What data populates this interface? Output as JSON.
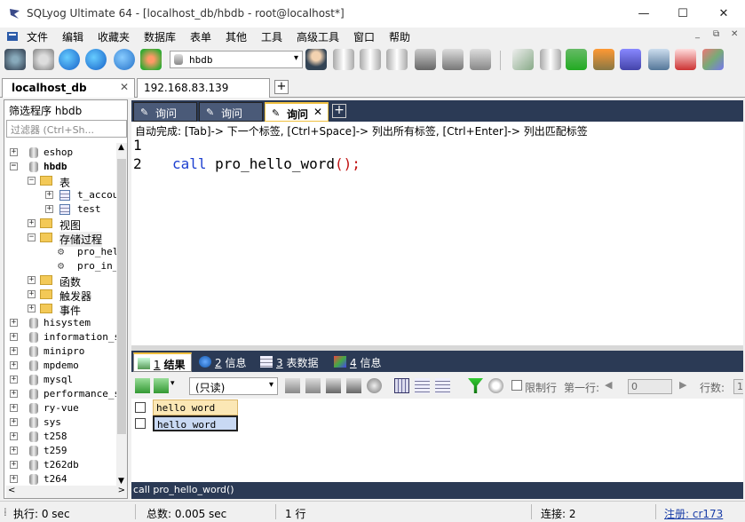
{
  "window": {
    "title": "SQLyog Ultimate 64 - [localhost_db/hbdb - root@localhost*]"
  },
  "menu": [
    "文件",
    "编辑",
    "收藏夹",
    "数据库",
    "表单",
    "其他",
    "工具",
    "高级工具",
    "窗口",
    "帮助"
  ],
  "toolbar": {
    "db_select": "hbdb"
  },
  "connections": [
    {
      "label": "localhost_db"
    },
    {
      "label": "192.168.83.139"
    }
  ],
  "left": {
    "filter_label": "筛选程序 hbdb",
    "filter_placeholder": "过滤器 (Ctrl+Sh...",
    "tree": [
      {
        "label": "eshop"
      },
      {
        "label": "hbdb"
      },
      {
        "label": "表"
      },
      {
        "label": "t_accou"
      },
      {
        "label": "test"
      },
      {
        "label": "视图"
      },
      {
        "label": "存储过程"
      },
      {
        "label": "pro_hel"
      },
      {
        "label": "pro_in_"
      },
      {
        "label": "函数"
      },
      {
        "label": "触发器"
      },
      {
        "label": "事件"
      },
      {
        "label": "hisystem"
      },
      {
        "label": "information_s"
      },
      {
        "label": "minipro"
      },
      {
        "label": "mpdemo"
      },
      {
        "label": "mysql"
      },
      {
        "label": "performance_s"
      },
      {
        "label": "ry-vue"
      },
      {
        "label": "sys"
      },
      {
        "label": "t258"
      },
      {
        "label": "t259"
      },
      {
        "label": "t262db"
      },
      {
        "label": "t264"
      }
    ]
  },
  "query_tabs": [
    {
      "label": "询问"
    },
    {
      "label": "询问"
    },
    {
      "label": "询问"
    }
  ],
  "editor": {
    "hint": "自动完成:  [Tab]-> 下一个标签, [Ctrl+Space]-> 列出所有标签, [Ctrl+Enter]-> 列出匹配标签",
    "line_numbers": [
      "1",
      "2"
    ],
    "keyword": "call",
    "proc": "pro_hello_word",
    "parens": "()",
    "semi": ";"
  },
  "result_tabs": [
    {
      "num": "1",
      "label": "结果"
    },
    {
      "num": "2",
      "label": "信息"
    },
    {
      "num": "3",
      "label": "表数据"
    },
    {
      "num": "4",
      "label": "信息"
    }
  ],
  "result_toolbar": {
    "mode": "(只读)",
    "limit_label": "限制行",
    "first_row_label": "第一行:",
    "first_row_value": "0",
    "rows_label": "行数:",
    "rows_value": "1"
  },
  "grid": {
    "header": "hello word",
    "rows": [
      "hello word"
    ]
  },
  "sql_status": "call pro_hello_word()",
  "status": {
    "exec": "执行: 0 sec",
    "total": "总数: 0.005 sec",
    "rows": "1 行",
    "conn": "连接: 2",
    "register": "注册: cr173"
  }
}
